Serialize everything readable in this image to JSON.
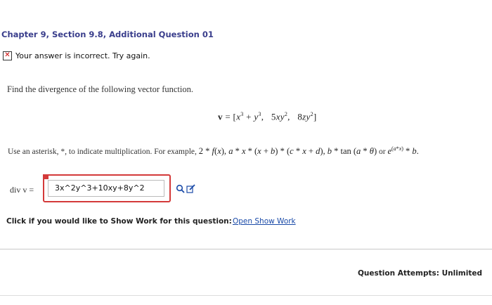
{
  "header": {
    "chapter_title": "Chapter 9, Section 9.8, Additional Question 01"
  },
  "status": {
    "icon": "incorrect-x-icon",
    "message": "Your answer is incorrect.  Try again.",
    "color": "#cc0000"
  },
  "question": {
    "prompt": "Find the divergence of the following vector function.",
    "hint_prefix": "Use an asterisk, *, to indicate multiplication. For example,",
    "hint_or": "or"
  },
  "answer": {
    "label": "div v =",
    "value": "3x^2y^3+10xy+8y^2",
    "frame_color": "#d43a3a"
  },
  "tools": {
    "preview_icon": "magnifier-icon",
    "edit_icon": "pencil-edit-icon"
  },
  "show_work": {
    "prompt": "Click if you would like to Show Work for this question:",
    "link": "Open Show Work"
  },
  "footer": {
    "attempts": "Question Attempts: Unlimited"
  }
}
